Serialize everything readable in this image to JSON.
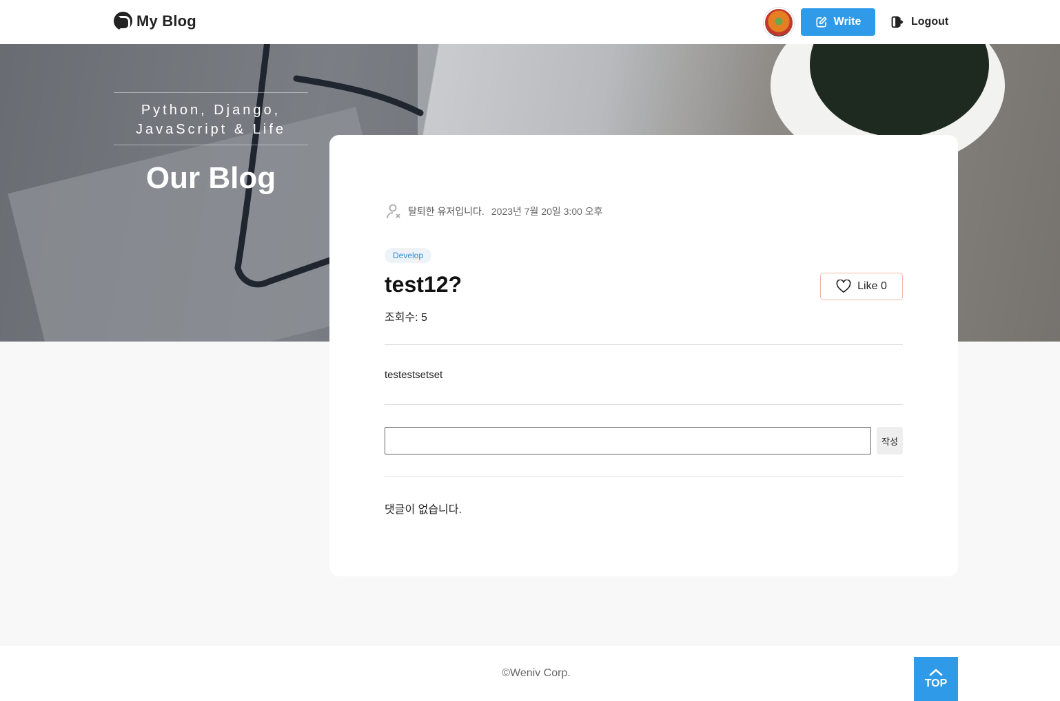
{
  "header": {
    "logo_text": "My Blog",
    "write_label": "Write",
    "logout_label": "Logout"
  },
  "hero": {
    "tagline_line1": "Python, Django,",
    "tagline_line2": "JavaScript & Life",
    "title": "Our Blog"
  },
  "post": {
    "author": "탈퇴한 유저입니다.",
    "date": "2023년 7월 20일 3:00 오후",
    "category": "Develop",
    "title": "test12?",
    "like_label": "Like 0",
    "views": "조회수: 5",
    "body": "testestsetset"
  },
  "comments": {
    "input_value": "",
    "submit_label": "작성",
    "empty_text": "댓글이 없습니다."
  },
  "footer": {
    "copyright": "©Weniv Corp.",
    "top_label": "TOP"
  },
  "colors": {
    "accent": "#2f9be8",
    "like_border": "#f0b8a8",
    "tag_text": "#2f88d0"
  },
  "icons": {
    "logo": "blog-logo-icon",
    "write": "edit-icon",
    "logout": "logout-icon",
    "author": "deleted-user-icon",
    "like": "heart-icon",
    "top": "chevron-up-icon"
  }
}
